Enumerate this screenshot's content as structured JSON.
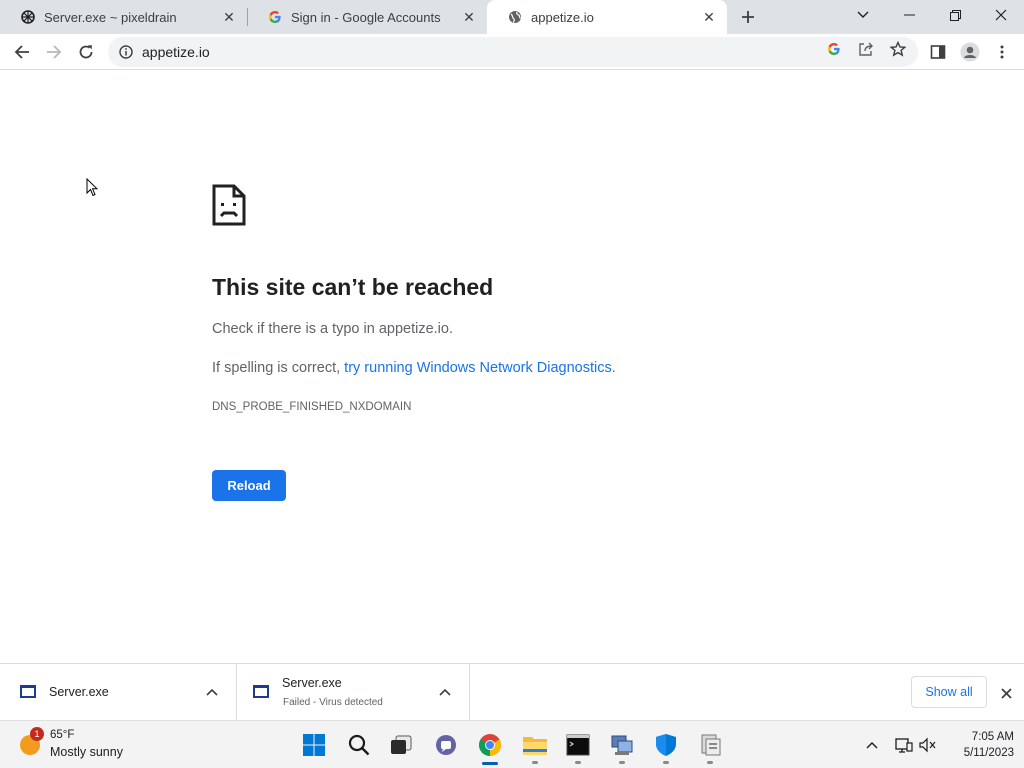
{
  "browser": {
    "tabs": [
      {
        "label": "Server.exe ~ pixeldrain",
        "icon": "pixeldrain-icon",
        "active": false
      },
      {
        "label": "Sign in - Google Accounts",
        "icon": "google-icon",
        "active": false
      },
      {
        "label": "appetize.io",
        "icon": "globe-icon",
        "active": true
      }
    ],
    "address": "appetize.io"
  },
  "error": {
    "title": "This site can’t be reached",
    "line1": "Check if there is a typo in appetize.io.",
    "line2_prefix": "If spelling is correct, ",
    "line2_link": "try running Windows Network Diagnostics",
    "line2_suffix": ".",
    "code": "DNS_PROBE_FINISHED_NXDOMAIN",
    "reload_label": "Reload"
  },
  "downloads": {
    "items": [
      {
        "name": "Server.exe",
        "status": ""
      },
      {
        "name": "Server.exe",
        "status": "Failed - Virus detected"
      }
    ],
    "show_all_label": "Show all"
  },
  "taskbar": {
    "weather": {
      "badge": "1",
      "temp": "65°F",
      "condition": "Mostly sunny"
    },
    "time": "7:05 AM",
    "date": "5/11/2023"
  },
  "colors": {
    "accent": "#1a73e8",
    "tabstrip": "#dee1e6",
    "error_text": "#5f6368"
  }
}
